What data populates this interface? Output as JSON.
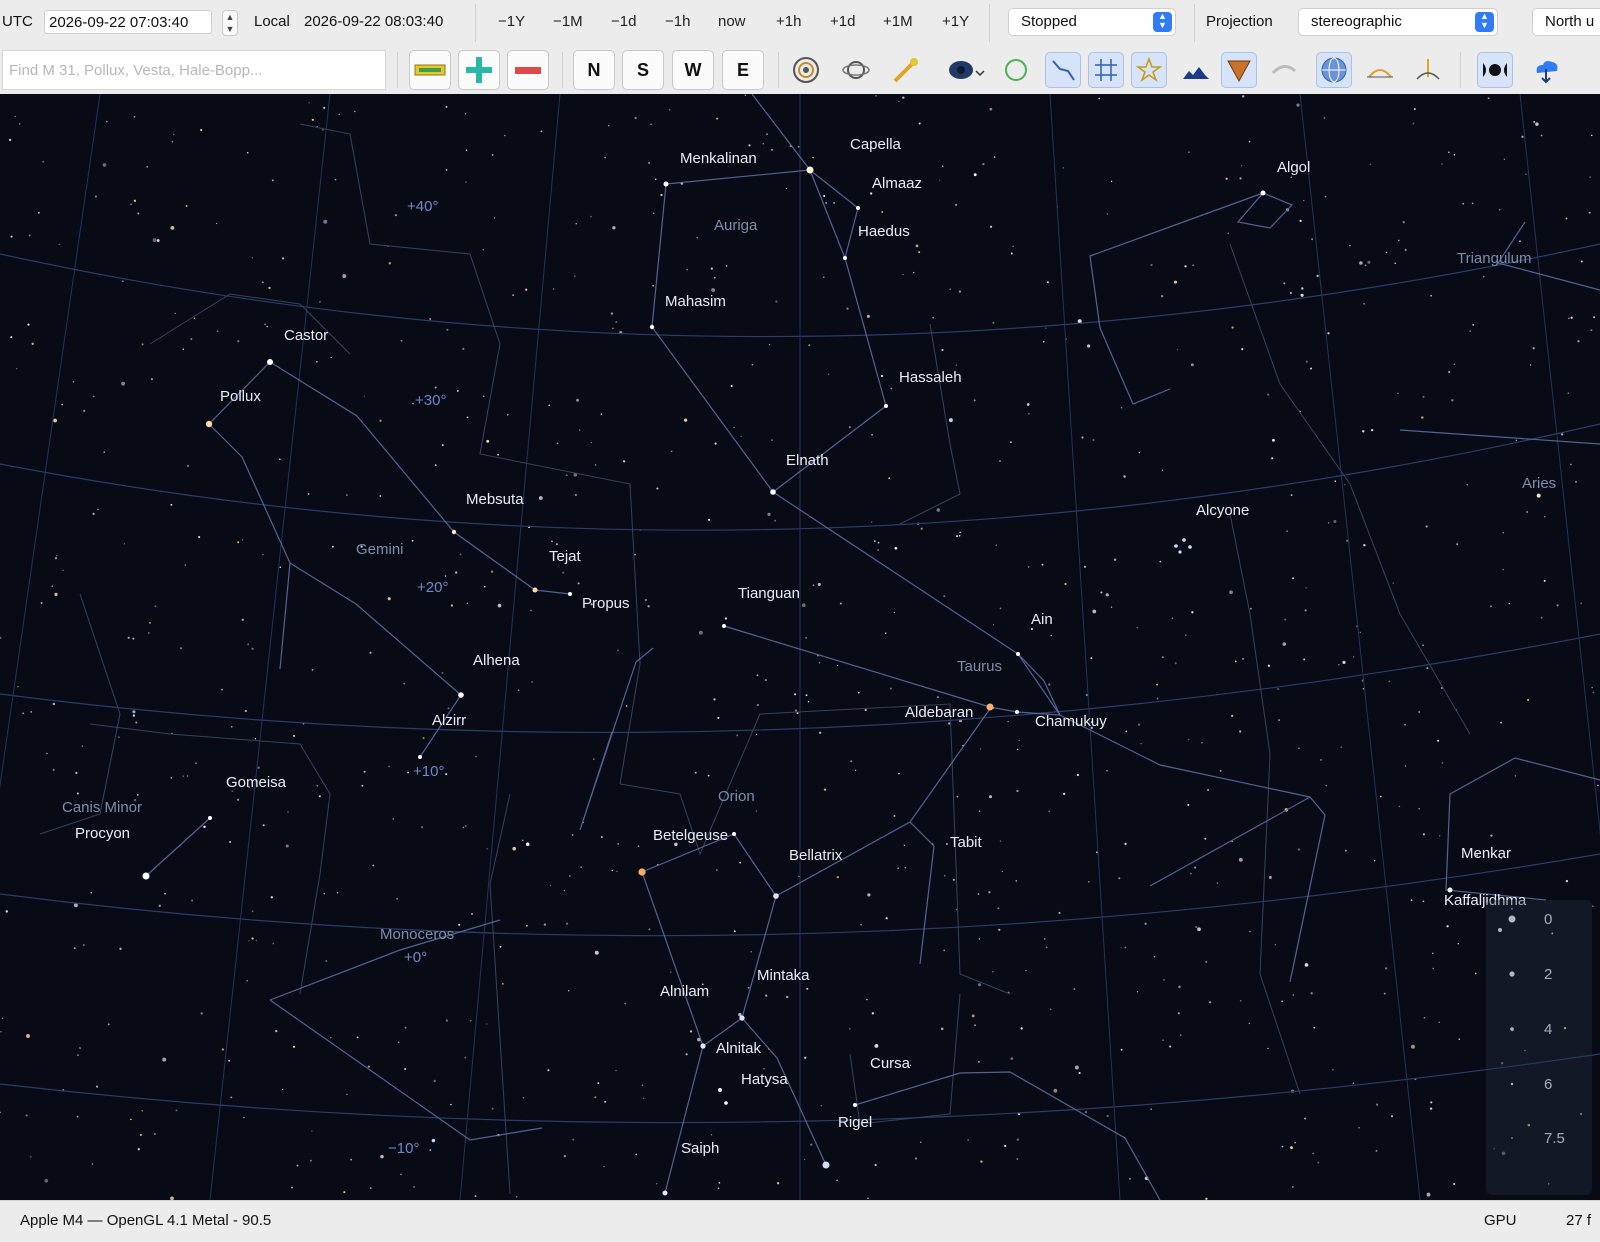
{
  "toolbar": {
    "utc_label": "UTC",
    "utc_value": "2026-09-22 07:03:40",
    "local_label": "Local",
    "local_value": "2026-09-22 08:03:40",
    "time_steps": [
      "−1Y",
      "−1M",
      "−1d",
      "−1h",
      "now",
      "+1h",
      "+1d",
      "+1M",
      "+1Y"
    ],
    "clock_state": "Stopped",
    "projection_label": "Projection",
    "projection_value": "stereographic",
    "orientation_value": "North u",
    "search_placeholder": "Find M 31, Pollux, Vesta, Hale-Bopp...",
    "directions": [
      "N",
      "S",
      "W",
      "E"
    ],
    "icons": [
      "measure-ruler-icon",
      "zoom-in-icon",
      "zoom-out-icon",
      "deep-sky-object-icon",
      "planet-icon",
      "comet-icon",
      "galaxy-icon",
      "circle-icon",
      "constellation-lines-icon",
      "grid-icon",
      "star-labels-icon",
      "horizon-icon",
      "ecliptic-icon",
      "milky-way-icon",
      "sphere-projection-icon",
      "observer-icon",
      "observer-location-icon",
      "moon-phase-icon",
      "cloud-download-icon"
    ]
  },
  "sky": {
    "star_labels": [
      "Menkalinan",
      "Capella",
      "Almaaz",
      "Haedus",
      "Auriga",
      "Mahasim",
      "Algol",
      "Triangulum",
      "Castor",
      "Pollux",
      "Hassaleh",
      "Elnath",
      "Mebsuta",
      "Tejat",
      "Propus",
      "Gemini",
      "Alcyone",
      "Tianguan",
      "Ain",
      "Alhena",
      "Alzirr",
      "Aldebaran",
      "Chamukuy",
      "Gomeisa",
      "Procyon",
      "Betelgeuse",
      "Bellatrix",
      "Tabit",
      "Mintaka",
      "Alnilam",
      "Alnitak",
      "Hatysa",
      "Cursa",
      "Rigel",
      "Saiph",
      "Menkar",
      "Kaffaljidhma"
    ],
    "constellations": [
      "Auriga",
      "Gemini",
      "Taurus",
      "Aries",
      "Orion",
      "Canis Minor",
      "Monoceros",
      "Triangulum"
    ],
    "grid_labels": [
      "+40°",
      "+30°",
      "+20°",
      "+10°",
      "+0°",
      "−10°"
    ],
    "magnitude_legend": [
      "0",
      "2",
      "4",
      "6",
      "7.5"
    ]
  },
  "status": {
    "renderer": "Apple M4 — OpenGL 4.1 Metal - 90.5",
    "gpu_label": "GPU",
    "fps": "27  f"
  }
}
